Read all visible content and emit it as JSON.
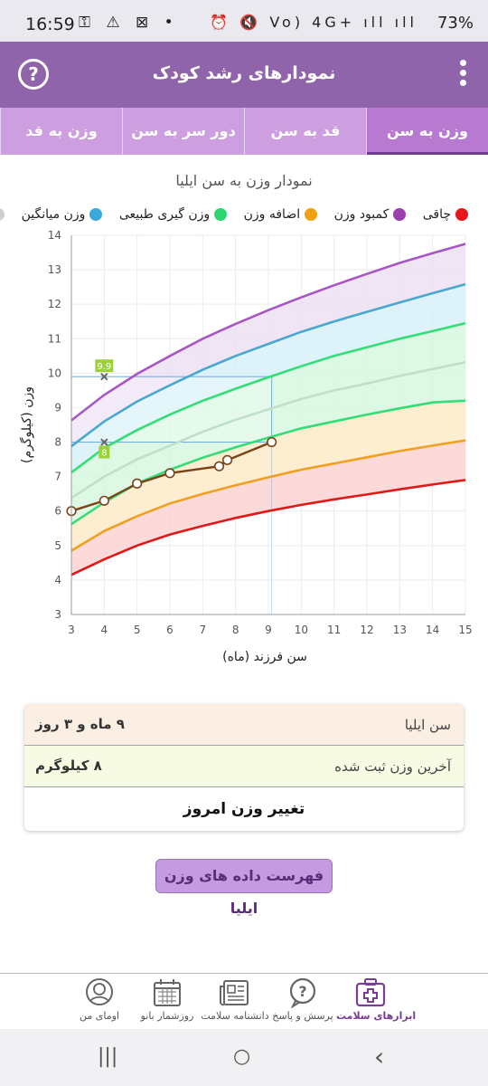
{
  "status_bar": {
    "time": "16:59",
    "left_icons": "⚿ ⚠ ⊠ •",
    "right_icons": "⏰ 🔇 Vo) 4G+ ıll ıll",
    "battery": "73%"
  },
  "app_bar": {
    "title": "نمودارهای رشد کودک",
    "help_label": "?"
  },
  "tabs": [
    {
      "label": "وزن به سن",
      "active": true
    },
    {
      "label": "قد به سن",
      "active": false
    },
    {
      "label": "دور سر به سن",
      "active": false
    },
    {
      "label": "وزن به قد",
      "active": false
    }
  ],
  "chart_title": "نمودار وزن به سن ایلیا",
  "legend": [
    {
      "label": "چاقی",
      "color": "#e8161b"
    },
    {
      "label": "کمبود وزن",
      "color": "#9b3fae"
    },
    {
      "label": "اضافه وزن",
      "color": "#f0a010"
    },
    {
      "label": "وزن گیری طبیعی",
      "color": "#2ed573"
    },
    {
      "label": "وزن میانگین",
      "color": "#3aa8d8"
    },
    {
      "label": "",
      "color": "#cfcfcf"
    }
  ],
  "chart_data": {
    "type": "line",
    "xlabel": "سن فرزند (ماه)",
    "ylabel": "وزن (کیلوگرم)",
    "xlim": [
      3,
      15
    ],
    "ylim": [
      3,
      14
    ],
    "x_ticks": [
      "3",
      "4",
      "5",
      "6",
      "7",
      "8",
      "9",
      "10",
      "11",
      "12",
      "13",
      "14",
      "15"
    ],
    "y_ticks": [
      "3",
      "4",
      "5",
      "6",
      "7",
      "8",
      "9",
      "10",
      "11",
      "12",
      "13",
      "14"
    ],
    "grid": true,
    "curves": [
      {
        "color": "#e01818",
        "fill": "#fcd3d3",
        "x": [
          3,
          4,
          5,
          6,
          7,
          8,
          9,
          10,
          11,
          12,
          13,
          14,
          15
        ],
        "y": [
          4.15,
          4.6,
          5.0,
          5.32,
          5.57,
          5.8,
          6.0,
          6.18,
          6.34,
          6.48,
          6.63,
          6.77,
          6.9
        ]
      },
      {
        "color": "#f0a020",
        "fill": "#feebc9",
        "x": [
          3,
          4,
          5,
          6,
          7,
          8,
          9,
          10,
          11,
          12,
          13,
          14,
          15
        ],
        "y": [
          4.85,
          5.42,
          5.85,
          6.22,
          6.5,
          6.75,
          6.98,
          7.2,
          7.38,
          7.56,
          7.74,
          7.9,
          8.05
        ]
      },
      {
        "color": "#33dd77",
        "fill": "#d7f7df",
        "x": [
          3,
          4,
          5,
          6,
          7,
          8,
          9,
          10,
          11,
          12,
          13,
          14,
          15
        ],
        "y": [
          5.62,
          6.25,
          6.8,
          7.2,
          7.55,
          7.85,
          8.13,
          8.4,
          8.6,
          8.8,
          8.98,
          9.15,
          9.2
        ]
      },
      {
        "color": "#bfe0c8",
        "fill": "#d7f7df",
        "x": [
          3,
          4,
          5,
          6,
          7,
          8,
          9,
          10,
          11,
          12,
          13,
          14,
          15
        ],
        "y": [
          6.38,
          7.0,
          7.5,
          7.9,
          8.3,
          8.65,
          8.95,
          9.25,
          9.5,
          9.7,
          9.92,
          10.12,
          10.32
        ]
      },
      {
        "color": "#33dd77",
        "fill": "#d7f1f8",
        "x": [
          3,
          4,
          5,
          6,
          7,
          8,
          9,
          10,
          11,
          12,
          13,
          14,
          15
        ],
        "y": [
          7.12,
          7.83,
          8.35,
          8.8,
          9.2,
          9.55,
          9.88,
          10.2,
          10.5,
          10.75,
          11.0,
          11.22,
          11.45
        ]
      },
      {
        "color": "#4aa8d0",
        "fill": "#ece0f3",
        "x": [
          3,
          4,
          5,
          6,
          7,
          8,
          9,
          10,
          11,
          12,
          13,
          14,
          15
        ],
        "y": [
          7.88,
          8.6,
          9.18,
          9.65,
          10.1,
          10.5,
          10.85,
          11.2,
          11.5,
          11.78,
          12.05,
          12.32,
          12.58
        ]
      },
      {
        "color": "#a856c3",
        "fill": null,
        "x": [
          3,
          4,
          5,
          6,
          7,
          8,
          9,
          10,
          11,
          12,
          13,
          14,
          15
        ],
        "y": [
          8.63,
          9.37,
          9.98,
          10.5,
          11.0,
          11.43,
          11.83,
          12.2,
          12.55,
          12.88,
          13.2,
          13.48,
          13.75
        ]
      }
    ],
    "child_series": {
      "name": "ایلیا",
      "color": "#7a4418",
      "x": [
        3,
        4,
        5,
        6,
        7.5,
        7.75,
        9.1
      ],
      "y": [
        6.0,
        6.3,
        6.8,
        7.1,
        7.3,
        7.48,
        8.0
      ]
    },
    "highlight": {
      "age": 9.1,
      "weight": 8,
      "month_marker": 4,
      "upper_marker_value": 9.9,
      "lower_marker_value": 8
    },
    "annotations": [
      "9.9",
      "8"
    ]
  },
  "info": {
    "age_label": "سن ایلیا",
    "age_value": "۹ ماه و ۳ روز",
    "weight_label": "آخرین وزن ثبت شده",
    "weight_value": "۸ کیلوگرم",
    "change_button": "تغییر وزن امروز"
  },
  "list_button": "فهرست داده های وزن ایلیا",
  "bottom_nav": [
    {
      "label": "ابزارهای سلامت",
      "icon": "medical-kit-icon",
      "active": true
    },
    {
      "label": "پرسش و پاسخ",
      "icon": "question-bubble-icon",
      "active": false
    },
    {
      "label": "دانشنامه سلامت",
      "icon": "newspaper-icon",
      "active": false
    },
    {
      "label": "روزشمار بانو",
      "icon": "calendar-icon",
      "active": false
    },
    {
      "label": "اومای من",
      "icon": "profile-icon",
      "active": false
    }
  ],
  "system_nav": {
    "recents": "|||",
    "home": "○",
    "back": "‹"
  }
}
